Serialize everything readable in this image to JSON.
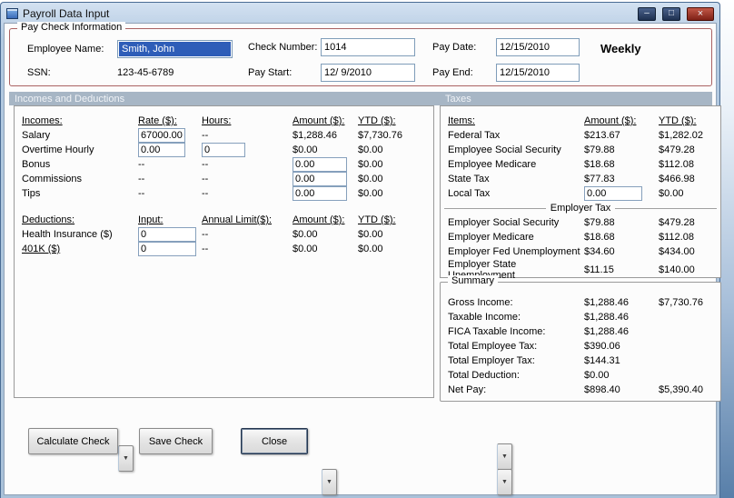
{
  "window": {
    "title": "Payroll Data Input",
    "controls": {
      "minimize": "–",
      "maximize": "□",
      "close": "×"
    }
  },
  "icons": {
    "dropdown_arrow": "▼"
  },
  "colors": {
    "selection_blue": "#2e5db8",
    "paycheck_border": "#aa6262",
    "band_bg": "#a7b6c5",
    "close_button_red": "#7e2015",
    "titlebar_blue": "#b3cae1"
  },
  "paycheck": {
    "legend": "Pay Check Information",
    "employee_name_label": "Employee Name:",
    "employee_name_value": "Smith, John",
    "ssn_label": "SSN:",
    "ssn_value": "123-45-6789",
    "check_number_label": "Check Number:",
    "check_number_value": "1014",
    "pay_start_label": "Pay Start:",
    "pay_start_value": "12/ 9/2010",
    "pay_date_label": "Pay Date:",
    "pay_date_value": "12/15/2010",
    "pay_end_label": "Pay End:",
    "pay_end_value": "12/15/2010",
    "frequency": "Weekly"
  },
  "sections": {
    "left": "Incomes and Deductions",
    "right": "Taxes"
  },
  "incomes": {
    "headers": {
      "col1": "Incomes:",
      "col2": "Rate ($):",
      "col3": "Hours:",
      "col4": "Amount ($):",
      "col5": "YTD ($):"
    },
    "rows": [
      {
        "label": "Salary",
        "rate": "67000.00",
        "hours": "--",
        "amount": "$1,288.46",
        "ytd": "$7,730.76"
      },
      {
        "label": "Overtime Hourly",
        "rate": "0.00",
        "hours": "0",
        "amount": "$0.00",
        "ytd": "$0.00"
      },
      {
        "label": "Bonus",
        "rate": "--",
        "hours": "--",
        "amount": "0.00",
        "ytd": "$0.00"
      },
      {
        "label": "Commissions",
        "rate": "--",
        "hours": "--",
        "amount": "0.00",
        "ytd": "$0.00"
      },
      {
        "label": "Tips",
        "rate": "--",
        "hours": "--",
        "amount": "0.00",
        "ytd": "$0.00"
      }
    ]
  },
  "deductions": {
    "headers": {
      "col1": "Deductions:",
      "col2": "Input:",
      "col3": "Annual Limit($):",
      "col4": "Amount ($):",
      "col5": "YTD ($):"
    },
    "rows": [
      {
        "label": "Health Insurance  ($)",
        "input": "0",
        "limit": "--",
        "amount": "$0.00",
        "ytd": "$0.00"
      },
      {
        "label": "401K  ($)",
        "input": "0",
        "limit": "--",
        "amount": "$0.00",
        "ytd": "$0.00"
      }
    ]
  },
  "taxes": {
    "headers": {
      "col1": "Items:",
      "col2": "Amount ($):",
      "col3": "YTD ($):"
    },
    "employee_rows": [
      {
        "label": "Federal Tax",
        "amount": "$213.67",
        "ytd": "$1,282.02"
      },
      {
        "label": "Employee Social Security",
        "amount": "$79.88",
        "ytd": "$479.28"
      },
      {
        "label": "Employee Medicare",
        "amount": "$18.68",
        "ytd": "$112.08"
      },
      {
        "label": "State Tax",
        "amount": "$77.83",
        "ytd": "$466.98"
      },
      {
        "label": "Local Tax",
        "amount": "0.00",
        "ytd": "$0.00"
      }
    ],
    "employer_header": "Employer Tax",
    "employer_rows": [
      {
        "label": "Employer Social Security",
        "amount": "$79.88",
        "ytd": "$479.28"
      },
      {
        "label": "Employer Medicare",
        "amount": "$18.68",
        "ytd": "$112.08"
      },
      {
        "label": "Employer Fed Unemployment",
        "amount": "$34.60",
        "ytd": "$434.00"
      },
      {
        "label": "Employer State Unemployment",
        "amount": "$11.15",
        "ytd": "$140.00"
      }
    ]
  },
  "summary": {
    "legend": "Summary",
    "rows": [
      {
        "label": "Gross Income:",
        "amount": "$1,288.46",
        "ytd": "$7,730.76"
      },
      {
        "label": "Taxable Income:",
        "amount": "$1,288.46",
        "ytd": ""
      },
      {
        "label": "FICA Taxable Income:",
        "amount": "$1,288.46",
        "ytd": ""
      },
      {
        "label": "Total Employee Tax:",
        "amount": "$390.06",
        "ytd": ""
      },
      {
        "label": "Total Employer Tax:",
        "amount": "$144.31",
        "ytd": ""
      },
      {
        "label": "Total Deduction:",
        "amount": "$0.00",
        "ytd": ""
      },
      {
        "label": "Net Pay:",
        "amount": "$898.40",
        "ytd": "$5,390.40"
      }
    ]
  },
  "buttons": {
    "calculate": "Calculate Check",
    "save": "Save Check",
    "close": "Close"
  }
}
